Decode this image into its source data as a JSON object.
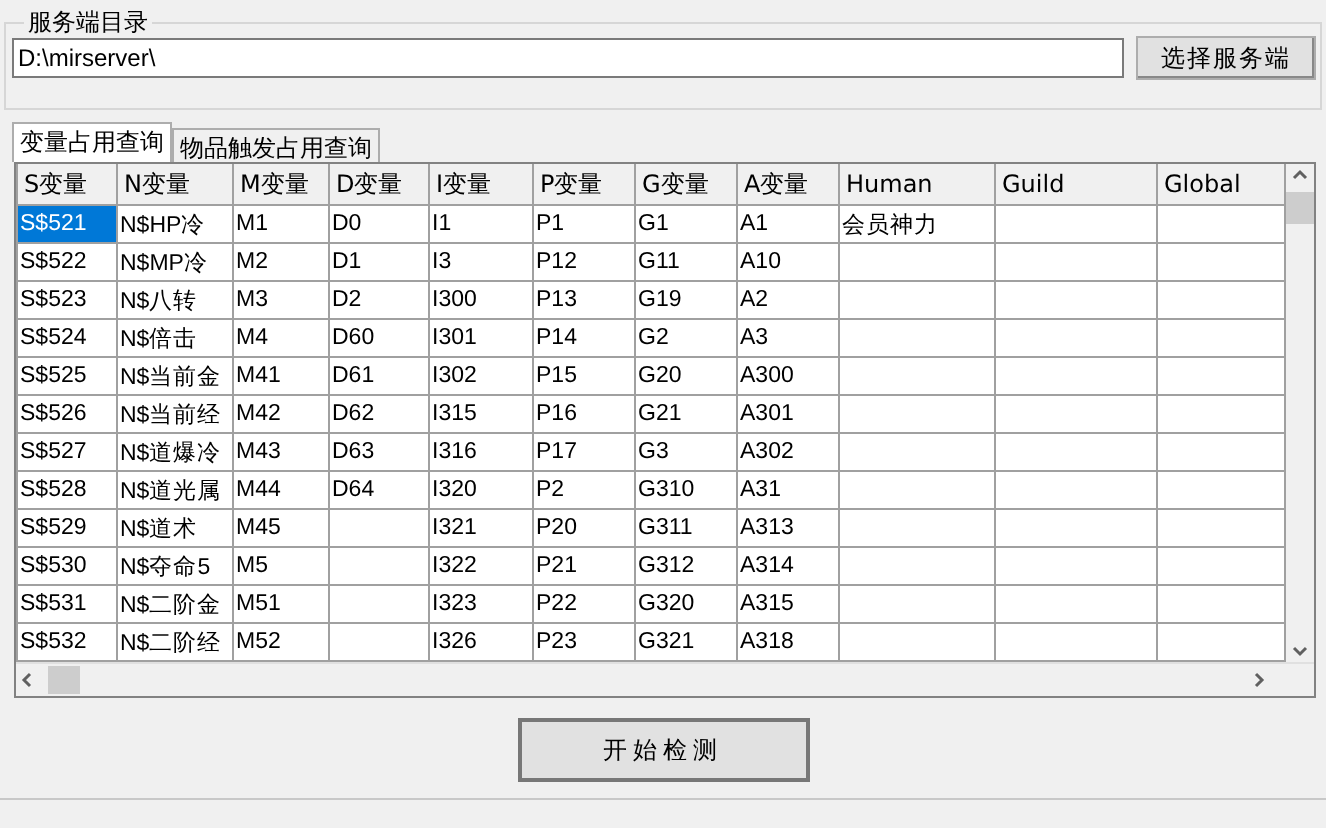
{
  "server_group": {
    "title": "服务端目录",
    "path_value": "D:\\mirserver\\",
    "button": "选择服务端"
  },
  "tabs": [
    {
      "label": "变量占用查询",
      "selected": true
    },
    {
      "label": "物品触发占用查询",
      "selected": false
    }
  ],
  "table": {
    "columns": [
      "S变量",
      "N变量",
      "M变量",
      "D变量",
      "I变量",
      "P变量",
      "G变量",
      "A变量",
      "Human",
      "Guild",
      "Global"
    ],
    "rows": [
      {
        "selected": true,
        "cells": [
          "S$521",
          "N$HP冷",
          "M1",
          "D0",
          "I1",
          "P1",
          "G1",
          "A1",
          "会员神力",
          "",
          ""
        ]
      },
      {
        "selected": false,
        "cells": [
          "S$522",
          "N$MP冷",
          "M2",
          "D1",
          "I3",
          "P12",
          "G11",
          "A10",
          "",
          "",
          ""
        ]
      },
      {
        "selected": false,
        "cells": [
          "S$523",
          "N$八转",
          "M3",
          "D2",
          "I300",
          "P13",
          "G19",
          "A2",
          "",
          "",
          ""
        ]
      },
      {
        "selected": false,
        "cells": [
          "S$524",
          "N$倍击",
          "M4",
          "D60",
          "I301",
          "P14",
          "G2",
          "A3",
          "",
          "",
          ""
        ]
      },
      {
        "selected": false,
        "cells": [
          "S$525",
          "N$当前金",
          "M41",
          "D61",
          "I302",
          "P15",
          "G20",
          "A300",
          "",
          "",
          ""
        ]
      },
      {
        "selected": false,
        "cells": [
          "S$526",
          "N$当前经",
          "M42",
          "D62",
          "I315",
          "P16",
          "G21",
          "A301",
          "",
          "",
          ""
        ]
      },
      {
        "selected": false,
        "cells": [
          "S$527",
          "N$道爆冷",
          "M43",
          "D63",
          "I316",
          "P17",
          "G3",
          "A302",
          "",
          "",
          ""
        ]
      },
      {
        "selected": false,
        "cells": [
          "S$528",
          "N$道光属",
          "M44",
          "D64",
          "I320",
          "P2",
          "G310",
          "A31",
          "",
          "",
          ""
        ]
      },
      {
        "selected": false,
        "cells": [
          "S$529",
          "N$道术",
          "M45",
          "",
          "I321",
          "P20",
          "G311",
          "A313",
          "",
          "",
          ""
        ]
      },
      {
        "selected": false,
        "cells": [
          "S$530",
          "N$夺命5",
          "M5",
          "",
          "I322",
          "P21",
          "G312",
          "A314",
          "",
          "",
          ""
        ]
      },
      {
        "selected": false,
        "cells": [
          "S$531",
          "N$二阶金",
          "M51",
          "",
          "I323",
          "P22",
          "G320",
          "A315",
          "",
          "",
          ""
        ]
      },
      {
        "selected": false,
        "cells": [
          "S$532",
          "N$二阶经",
          "M52",
          "",
          "I326",
          "P23",
          "G321",
          "A318",
          "",
          "",
          ""
        ]
      }
    ]
  },
  "start_button": "开始检测"
}
